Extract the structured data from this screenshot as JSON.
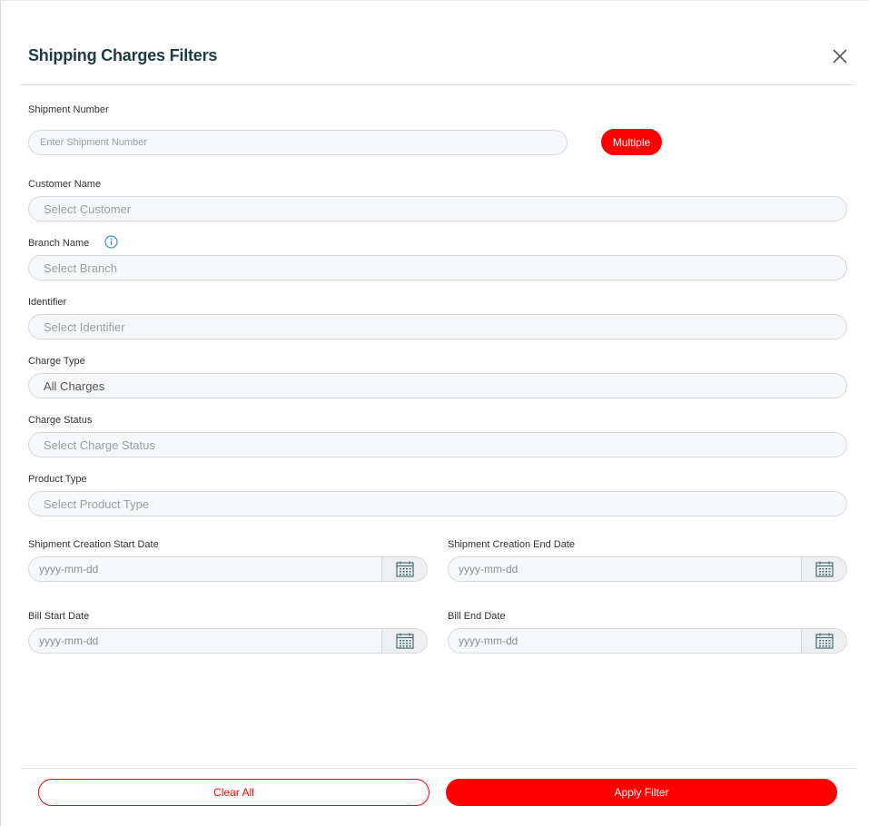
{
  "header": {
    "title": "Shipping Charges Filters"
  },
  "fields": {
    "shipment_number": {
      "label": "Shipment Number",
      "placeholder": "Enter Shipment Number",
      "multiple_label": "Multiple"
    },
    "customer_name": {
      "label": "Customer Name",
      "placeholder": "Select Customer"
    },
    "branch_name": {
      "label": "Branch Name",
      "placeholder": "Select Branch",
      "info_icon": "info-icon"
    },
    "identifier": {
      "label": "Identifier",
      "placeholder": "Select Identifier"
    },
    "charge_type": {
      "label": "Charge Type",
      "value": "All Charges"
    },
    "charge_status": {
      "label": "Charge Status",
      "placeholder": "Select Charge Status"
    },
    "product_type": {
      "label": "Product Type",
      "placeholder": "Select Product Type"
    },
    "shipment_creation_start_date": {
      "label": "Shipment Creation Start Date",
      "placeholder": "yyyy-mm-dd"
    },
    "shipment_creation_end_date": {
      "label": "Shipment Creation End Date",
      "placeholder": "yyyy-mm-dd"
    },
    "bill_start_date": {
      "label": "Bill Start Date",
      "placeholder": "yyyy-mm-dd"
    },
    "bill_end_date": {
      "label": "Bill End Date",
      "placeholder": "yyyy-mm-dd"
    }
  },
  "footer": {
    "clear_label": "Clear All",
    "apply_label": "Apply Filter"
  },
  "colors": {
    "accent": "#ff0000",
    "title": "#1f3b3f",
    "info": "#3b8ede",
    "calendar": "#4a6b70"
  },
  "icons": {
    "close": "close-icon",
    "calendar": "calendar-icon",
    "info": "info-icon"
  }
}
